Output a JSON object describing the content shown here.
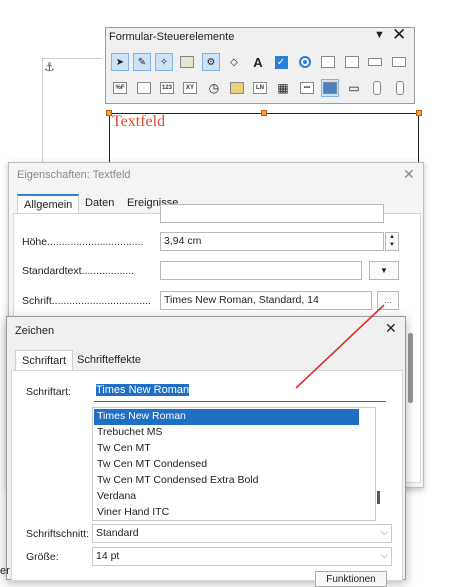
{
  "toolbar": {
    "title": "Formular-Steuerelemente",
    "row1_icons": [
      "select-icon",
      "design-mode-icon",
      "wizards-icon",
      "form-design-icon",
      "control-properties-icon",
      "form-properties-icon",
      "label-icon",
      "checkbox-icon",
      "option-button-icon",
      "listbox-icon",
      "image-button-icon",
      "button-icon",
      "push-button-icon"
    ],
    "row2_labels": [
      "%F",
      "",
      "123",
      "XY",
      "",
      "",
      "LN",
      "",
      "",
      "",
      "",
      "",
      ""
    ]
  },
  "document": {
    "textbox_label": "Textfeld",
    "edge_text": "er"
  },
  "properties_dialog": {
    "title": "Eigenschaften: Textfeld",
    "tabs": [
      "Allgemein",
      "Daten",
      "Ereignisse"
    ],
    "fields": {
      "height_label": "Höhe",
      "height_value": "3,94 cm",
      "default_text_label": "Standardtext",
      "default_text_value": "",
      "font_label": "Schrift",
      "font_value": "Times New Roman, Standard, 14",
      "font_button": "..."
    }
  },
  "zeichen_dialog": {
    "title": "Zeichen",
    "tabs": [
      "Schriftart",
      "Schrifteffekte"
    ],
    "font_label": "Schriftart:",
    "font_value": "Times New Roman",
    "font_list": [
      "Times New Roman",
      "Trebuchet MS",
      "Tw Cen MT",
      "Tw Cen MT Condensed",
      "Tw Cen MT Condensed Extra Bold",
      "Verdana",
      "Viner Hand ITC"
    ],
    "style_label": "Schriftschnitt:",
    "style_value": "Standard",
    "size_label": "Größe:",
    "size_value": "14 pt",
    "functions_button": "Funktionen"
  },
  "colors": {
    "accent": "#1f6fc5",
    "textbox_label": "#e34a2a",
    "annotation_line": "#d8312c"
  }
}
